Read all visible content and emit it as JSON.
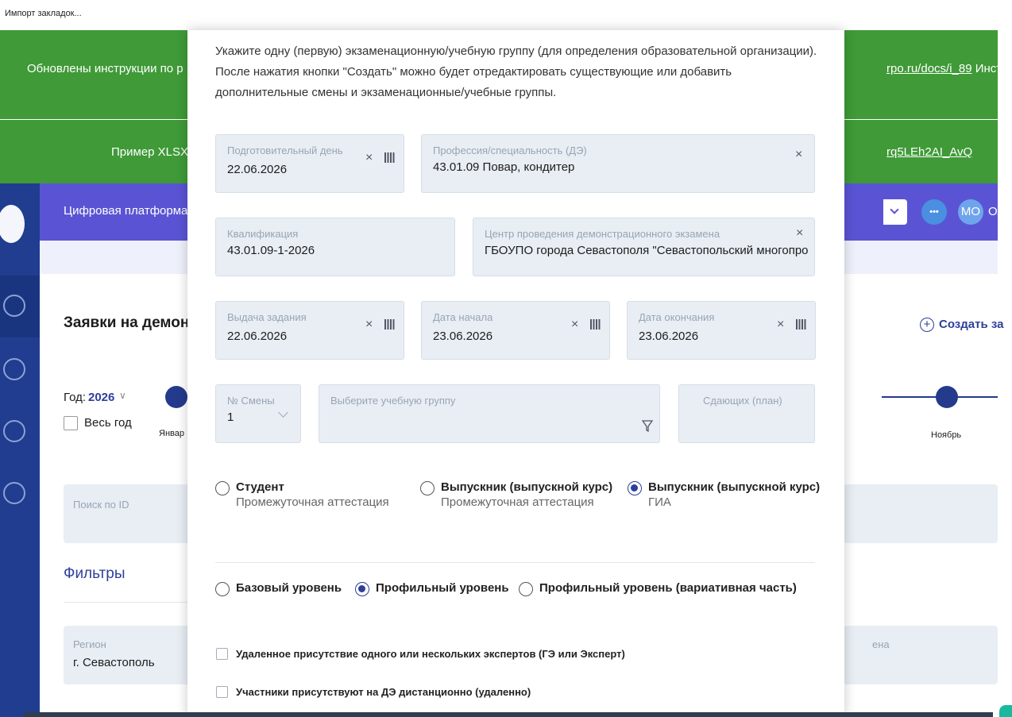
{
  "bookmark_bar": {
    "item": "Импорт закладок..."
  },
  "banners": {
    "first_left": "Обновлены инструкции по р",
    "first_link": "rpo.ru/docs/i_89",
    "first_right": " Инст",
    "second_left": "Пример XLSX-",
    "second_link": "rq5LEh2AI_AvQ"
  },
  "header": {
    "platform": "Цифровая платформа: д",
    "more_label": "•••",
    "avatar": "МО",
    "user_fragment": "О/"
  },
  "page": {
    "title": "Заявки на демонс",
    "create_label": "Создать за",
    "year_label": "Год:",
    "year_value": "2026",
    "whole_year": "Весь год",
    "month_left": "Январ",
    "month_right": "Ноябрь",
    "search_placeholder": "Поиск по ID",
    "filters": "Фильтры",
    "region_label": "Регион",
    "region_value": "г. Севастополь",
    "right_field_fragment": "ена"
  },
  "modal": {
    "intro": "Укажите одну (первую) экзаменационную/учебную группу (для определения образовательной организации). После нажатия кнопки \"Создать\" можно будет отредактировать существующие или добавить дополнительные смены и экзаменационные/учебные группы.",
    "prep_day": {
      "label": "Подготовительный день",
      "value": "22.06.2026"
    },
    "profession": {
      "label": "Профессия/специальность (ДЭ)",
      "value": "43.01.09 Повар, кондитер"
    },
    "qualification": {
      "label": "Квалификация",
      "value": "43.01.09-1-2026"
    },
    "center": {
      "label": "Центр проведения демонстрационного экзамена",
      "value": "ГБОУПО города Севастополя \"Севастопольский многопро"
    },
    "task_issue": {
      "label": "Выдача задания",
      "value": "22.06.2026"
    },
    "start_date": {
      "label": "Дата начала",
      "value": "23.06.2026"
    },
    "end_date": {
      "label": "Дата окончания",
      "value": "23.06.2026"
    },
    "shift": {
      "label": "№ Смены",
      "value": "1"
    },
    "group": {
      "label": "Выберите учебную группу"
    },
    "planned": {
      "label": "Сдающих (план)"
    },
    "clear_glyph": "×",
    "participant_types": [
      {
        "title": "Студент",
        "subtitle": "Промежуточная аттестация",
        "selected": false
      },
      {
        "title": "Выпускник (выпускной курс)",
        "subtitle": "Промежуточная аттестация",
        "selected": false
      },
      {
        "title": "Выпускник (выпускной курс)",
        "subtitle": "ГИА",
        "selected": true
      }
    ],
    "levels": [
      {
        "title": "Базовый уровень",
        "selected": false
      },
      {
        "title": "Профильный уровень",
        "selected": true
      },
      {
        "title": "Профильный уровень (вариативная часть)",
        "selected": false
      }
    ],
    "checkboxes": [
      "Удаленное присутствие одного или нескольких экспертов (ГЭ или Эксперт)",
      "Участники присутствуют на ДЭ дистанционно (удаленно)"
    ]
  },
  "colors": {
    "banner_green": "#3f9a37",
    "header_purple": "#5a54d4",
    "sidebar_blue": "#203d8f",
    "accent_navy": "#2e3f9a"
  }
}
